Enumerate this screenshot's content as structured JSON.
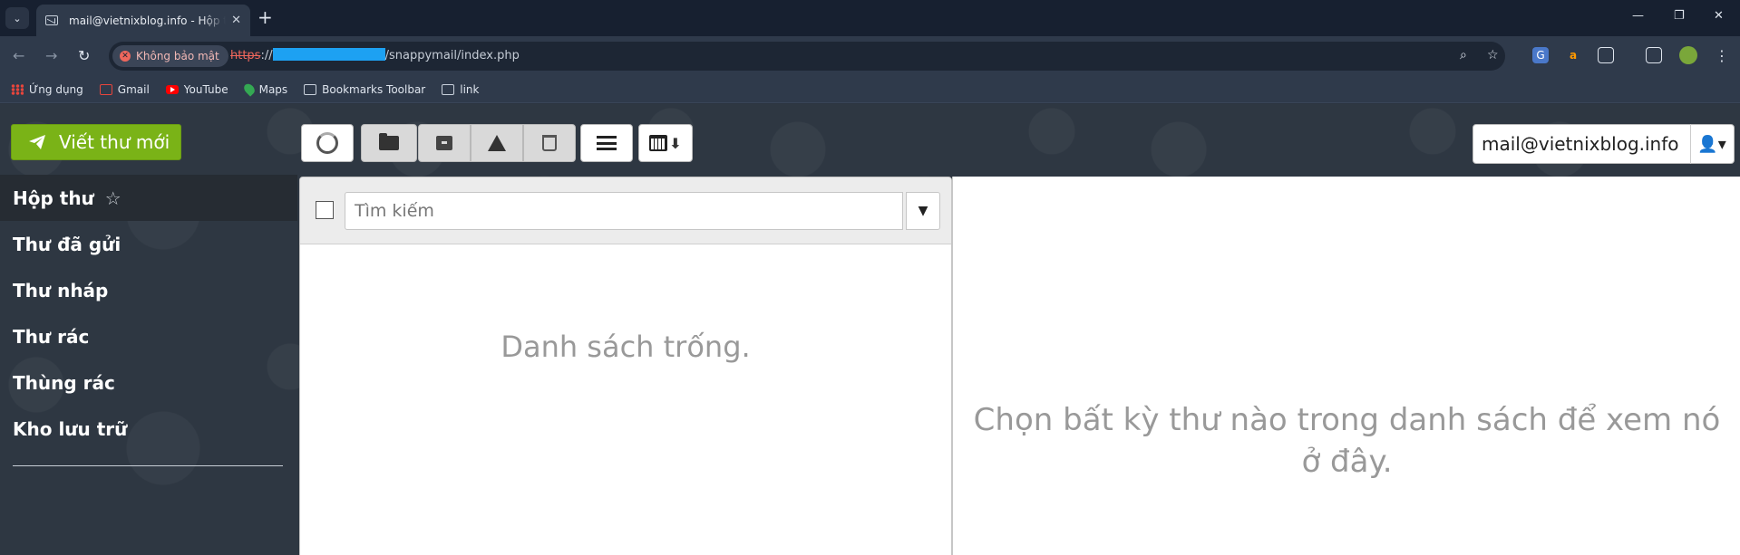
{
  "browser": {
    "tab_title": "mail@vietnixblog.info - Hộp thư",
    "security_label": "Không bảo mật",
    "url_protocol": "https",
    "url_sep": "://",
    "url_path": "/snappymail/index.php",
    "bookmarks": [
      {
        "label": "Ứng dụng",
        "icon": "apps-icon"
      },
      {
        "label": "Gmail",
        "icon": "gmail-icon"
      },
      {
        "label": "YouTube",
        "icon": "youtube-icon"
      },
      {
        "label": "Maps",
        "icon": "maps-icon"
      },
      {
        "label": "Bookmarks Toolbar",
        "icon": "folder-icon"
      },
      {
        "label": "link",
        "icon": "folder-icon"
      }
    ]
  },
  "mail": {
    "compose_label": "Viết thư mới",
    "folders": [
      {
        "label": "Hộp thư",
        "active": true
      },
      {
        "label": "Thư đã gửi"
      },
      {
        "label": "Thư nháp"
      },
      {
        "label": "Thư rác"
      },
      {
        "label": "Thùng rác"
      },
      {
        "label": "Kho lưu trữ"
      }
    ],
    "account_label": "mail@vietnixblog.info",
    "search_placeholder": "Tìm kiếm",
    "list_empty": "Danh sách trống.",
    "preview_empty": "Chọn bất kỳ thư nào trong danh sách để xem nó ở đây."
  },
  "colors": {
    "compose_green": "#7ab317",
    "sidebar_bg": "#2e3742",
    "active_folder_bg": "#262c33",
    "browser_frame": "#172030",
    "toolbar": "#2f3a4b"
  }
}
